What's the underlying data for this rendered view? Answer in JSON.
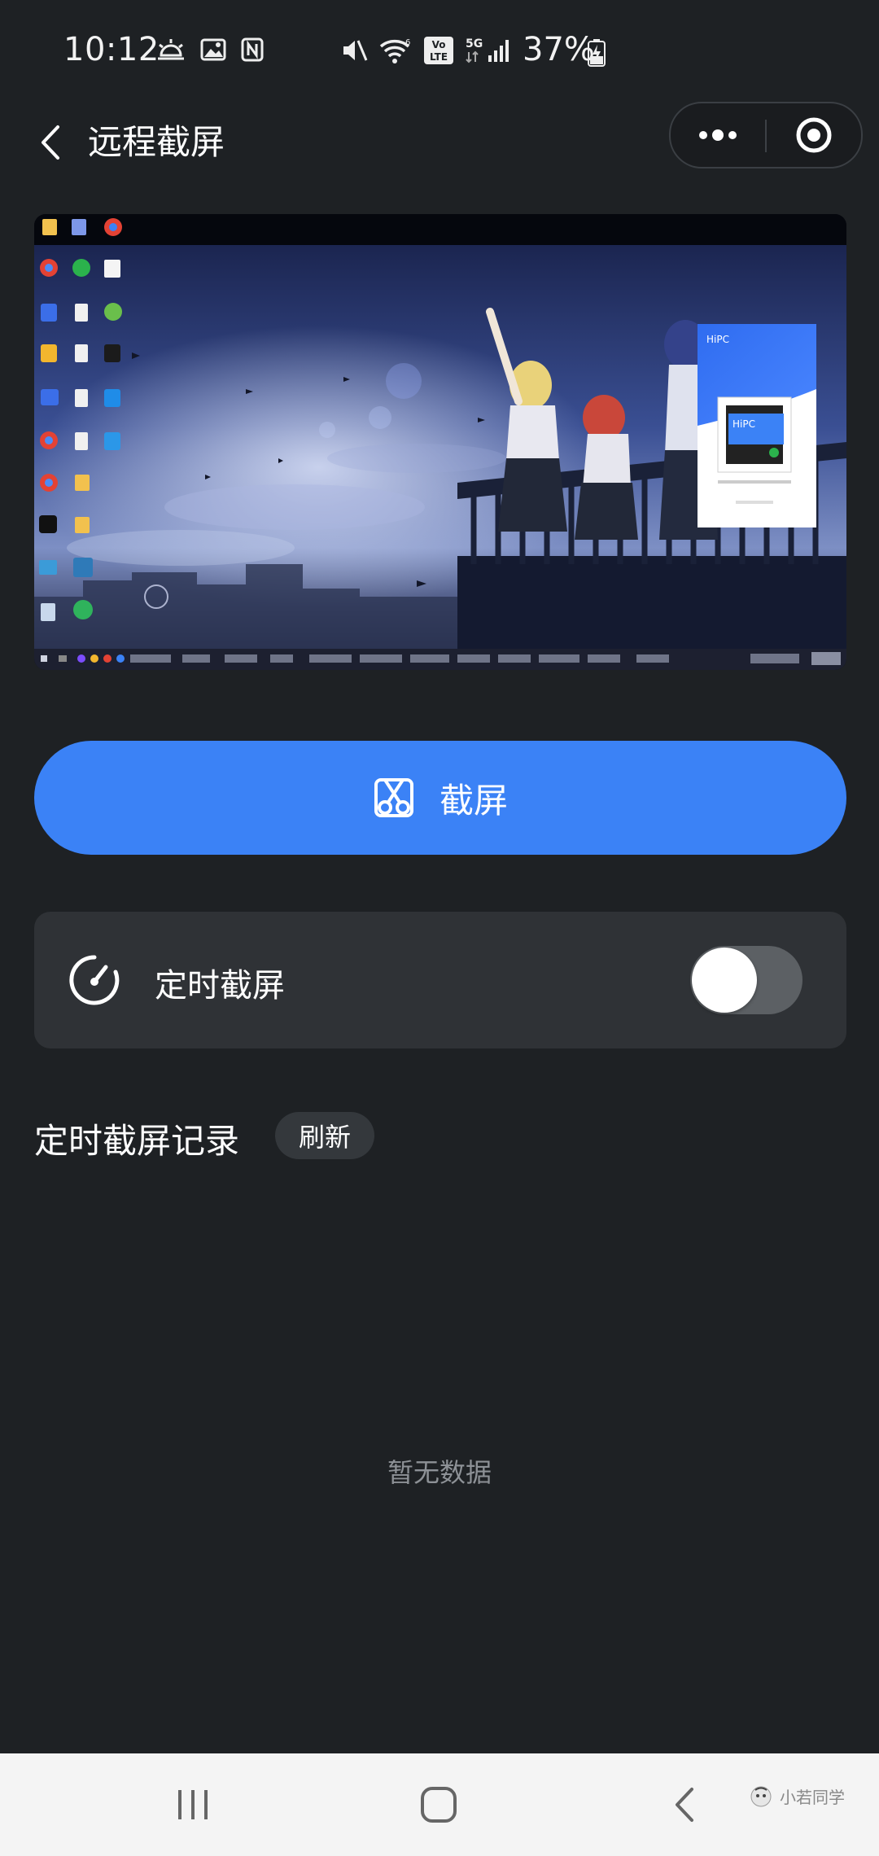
{
  "status_bar": {
    "time": "10:12",
    "battery_percent": "37%",
    "icons": [
      "weather-icon",
      "gallery-icon",
      "nfc-icon",
      "mute-icon",
      "wifi-icon",
      "volte-icon",
      "5g-signal-icon",
      "battery-charging-icon"
    ]
  },
  "nav": {
    "title": "远程截屏",
    "back_icon": "back-arrow-icon",
    "more_icon": "more-dots-icon",
    "close_icon": "target-close-icon"
  },
  "preview": {
    "popup_title": "HiPC",
    "popup_overlay": "HiPC"
  },
  "screenshot_button": {
    "label": "截屏",
    "icon": "scissors-icon",
    "color": "#3b82f6"
  },
  "timer": {
    "label": "定时截屏",
    "icon": "gauge-icon",
    "enabled": false
  },
  "records": {
    "title": "定时截屏记录",
    "refresh_label": "刷新",
    "empty_text": "暂无数据"
  },
  "system_nav": {
    "buttons": [
      "recent-apps-icon",
      "home-icon",
      "back-icon"
    ],
    "watermark": "小若同学"
  }
}
